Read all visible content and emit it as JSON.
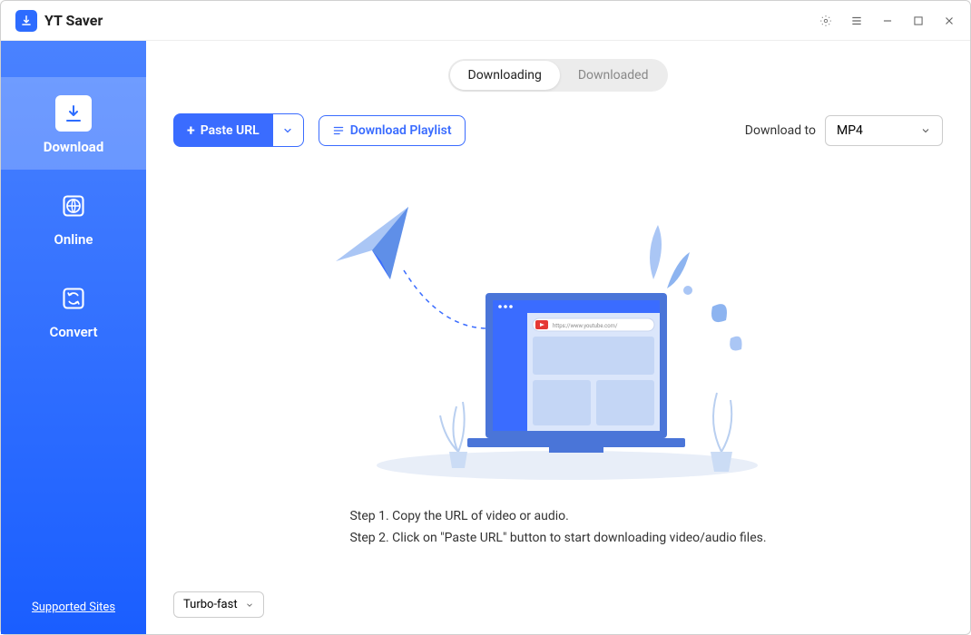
{
  "app": {
    "title": "YT Saver"
  },
  "sidebar": {
    "items": [
      {
        "label": "Download"
      },
      {
        "label": "Online"
      },
      {
        "label": "Convert"
      }
    ],
    "supported_sites": "Supported Sites"
  },
  "tabs": {
    "downloading": "Downloading",
    "downloaded": "Downloaded"
  },
  "toolbar": {
    "paste_url": "Paste URL",
    "download_playlist": "Download Playlist",
    "download_to_label": "Download to",
    "download_to_value": "MP4"
  },
  "illustration": {
    "url_text": "https://www.youtube.com/"
  },
  "steps": {
    "s1": "Step 1. Copy the URL of video or audio.",
    "s2": "Step 2. Click on \"Paste URL\" button to start downloading video/audio files."
  },
  "footer": {
    "speed": "Turbo-fast"
  }
}
